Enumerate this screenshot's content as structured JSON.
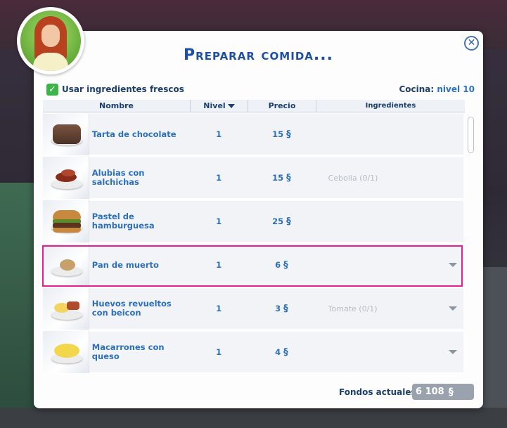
{
  "dialog": {
    "title": "Preparar comida...",
    "close_label": "✕",
    "fresh_checked": true,
    "fresh_label": "Usar ingredientes frescos",
    "skill_label": "Cocina:",
    "skill_value": "nivel 10"
  },
  "table": {
    "columns": {
      "name": "Nombre",
      "level": "Nivel",
      "price": "Precio",
      "ingredients": "Ingredientes"
    },
    "rows": [
      {
        "name": "Tarta de chocolate",
        "level": "1",
        "price": "15",
        "currency": "§",
        "ingredients": "",
        "expand": false,
        "icon": "chocolate-cake-icon"
      },
      {
        "name": "Alubias con salchichas",
        "level": "1",
        "price": "15",
        "currency": "§",
        "ingredients": "Cebolla (0/1)",
        "expand": false,
        "icon": "beans-sausages-icon"
      },
      {
        "name": "Pastel de hamburguesa",
        "level": "1",
        "price": "25",
        "currency": "§",
        "ingredients": "",
        "expand": false,
        "icon": "hamburger-cake-icon"
      },
      {
        "name": "Pan de muerto",
        "level": "1",
        "price": "6",
        "currency": "§",
        "ingredients": "",
        "expand": true,
        "icon": "pan-de-muerto-icon"
      },
      {
        "name": "Huevos revueltos con beicon",
        "level": "1",
        "price": "3",
        "currency": "§",
        "ingredients": "Tomate (0/1)",
        "expand": true,
        "icon": "eggs-bacon-icon"
      },
      {
        "name": "Macarrones con queso",
        "level": "1",
        "price": "4",
        "currency": "§",
        "ingredients": "",
        "expand": true,
        "icon": "mac-cheese-icon"
      }
    ],
    "highlighted_row": 3
  },
  "footer": {
    "funds_label": "Fondos actuales:",
    "funds_value": "6 108",
    "currency": "§"
  }
}
